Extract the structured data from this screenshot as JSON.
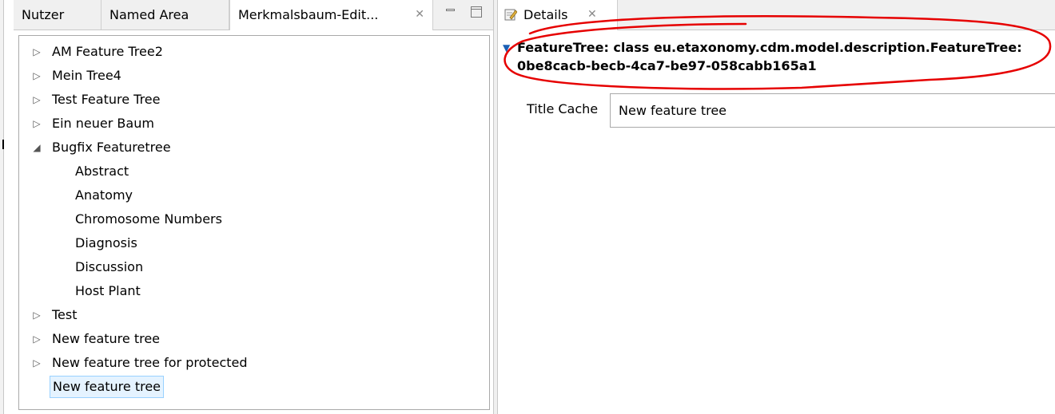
{
  "left_panel": {
    "tabs": [
      {
        "label": "Nutzer"
      },
      {
        "label": "Named Area"
      },
      {
        "label": "Merkmalsbaum-Edit..."
      }
    ],
    "tree": [
      {
        "label": "AM Feature Tree2",
        "expander": "collapsed"
      },
      {
        "label": "Mein Tree4",
        "expander": "collapsed"
      },
      {
        "label": "Test Feature Tree",
        "expander": "collapsed"
      },
      {
        "label": "Ein neuer Baum",
        "expander": "collapsed"
      },
      {
        "label": "Bugfix Featuretree",
        "expander": "expanded"
      },
      {
        "label": "Abstract",
        "expander": "none",
        "child": true
      },
      {
        "label": "Anatomy",
        "expander": "none",
        "child": true
      },
      {
        "label": "Chromosome Numbers",
        "expander": "none",
        "child": true
      },
      {
        "label": "Diagnosis",
        "expander": "none",
        "child": true
      },
      {
        "label": "Discussion",
        "expander": "none",
        "child": true
      },
      {
        "label": "Host Plant",
        "expander": "none",
        "child": true
      },
      {
        "label": "Test",
        "expander": "collapsed"
      },
      {
        "label": "New feature tree",
        "expander": "collapsed"
      },
      {
        "label": "New feature tree for protected",
        "expander": "collapsed"
      },
      {
        "label": "New feature tree",
        "expander": "none",
        "selected": true
      }
    ]
  },
  "right_panel": {
    "tab_label": "Details",
    "header_line1": "FeatureTree: class eu.etaxonomy.cdm.model.description.FeatureTree:",
    "header_line2": "0be8cacb-becb-4ca7-be97-058cabb165a1",
    "title_cache_label": "Title Cache",
    "title_cache_value": "New feature tree"
  },
  "colors": {
    "selection_bg": "#e5f3ff",
    "selection_border": "#99d1ff",
    "annotation_red": "#e60000",
    "section_triangle": "#1a5fb4"
  },
  "icons": [
    "close-icon",
    "minimize-icon",
    "maximize-icon",
    "details-editor-icon",
    "expand-arrow-icon",
    "collapse-arrow-icon"
  ]
}
